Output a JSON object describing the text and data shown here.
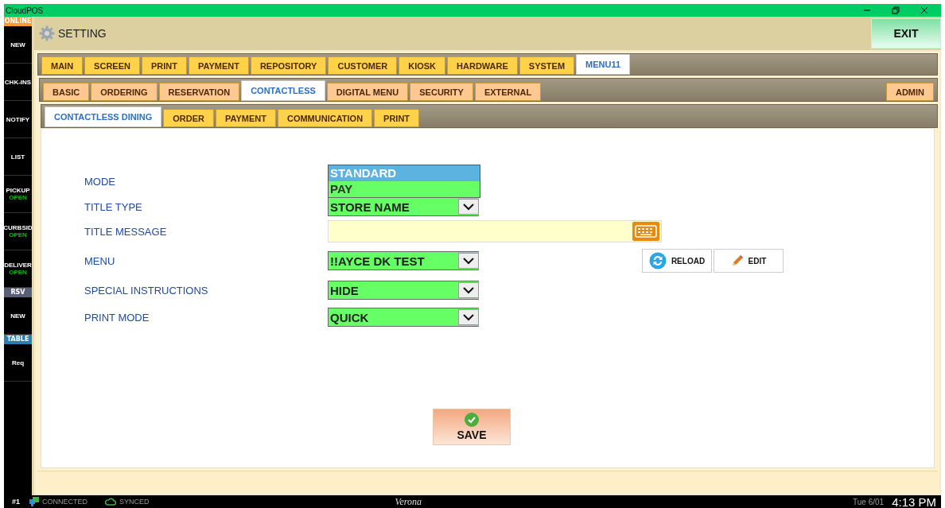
{
  "window": {
    "title": "CloudPOS"
  },
  "sidebar": {
    "items": [
      {
        "kind": "header",
        "label": "ONLINE",
        "color": "#ff9933"
      },
      {
        "kind": "button",
        "label": "NEW"
      },
      {
        "kind": "button",
        "label": "CHK-INS"
      },
      {
        "kind": "button",
        "label": "NOTIFY"
      },
      {
        "kind": "button",
        "label": "LIST"
      },
      {
        "kind": "button",
        "label": "PICKUP",
        "status": "OPEN"
      },
      {
        "kind": "button",
        "label": "CURBSID",
        "status": "OPEN"
      },
      {
        "kind": "button",
        "label": "DELIVER",
        "status": "OPEN"
      },
      {
        "kind": "header",
        "label": "RSV",
        "color": "#5a5f78"
      },
      {
        "kind": "button",
        "label": "NEW"
      },
      {
        "kind": "header",
        "label": "TABLE",
        "color": "#2a7fb0"
      },
      {
        "kind": "button",
        "label": "Req"
      }
    ]
  },
  "header": {
    "title": "SETTING",
    "exit_button": "EXIT"
  },
  "main_tabs": [
    {
      "label": "MAIN",
      "selected": false
    },
    {
      "label": "SCREEN",
      "selected": false
    },
    {
      "label": "PRINT",
      "selected": false
    },
    {
      "label": "PAYMENT",
      "selected": false
    },
    {
      "label": "REPOSITORY",
      "selected": false
    },
    {
      "label": "CUSTOMER",
      "selected": false
    },
    {
      "label": "KIOSK",
      "selected": false
    },
    {
      "label": "HARDWARE",
      "selected": false
    },
    {
      "label": "SYSTEM",
      "selected": false
    },
    {
      "label": "MENU11",
      "selected": true
    }
  ],
  "sub_tabs": [
    {
      "label": "BASIC",
      "selected": false
    },
    {
      "label": "ORDERING",
      "selected": false
    },
    {
      "label": "RESERVATION",
      "selected": false
    },
    {
      "label": "CONTACTLESS",
      "selected": true
    },
    {
      "label": "DIGITAL MENU",
      "selected": false
    },
    {
      "label": "SECURITY",
      "selected": false
    },
    {
      "label": "EXTERNAL",
      "selected": false
    }
  ],
  "admin_tab": {
    "label": "ADMIN",
    "selected": false
  },
  "section_tabs": [
    {
      "label": "CONTACTLESS DINING",
      "selected": true
    },
    {
      "label": "ORDER",
      "selected": false
    },
    {
      "label": "PAYMENT",
      "selected": false
    },
    {
      "label": "COMMUNICATION",
      "selected": false
    },
    {
      "label": "PRINT",
      "selected": false
    }
  ],
  "form": {
    "fields": [
      {
        "label": "MODE",
        "kind": "open_dropdown",
        "options": [
          {
            "label": "STANDARD",
            "selected": true
          },
          {
            "label": "PAY",
            "selected": false
          }
        ]
      },
      {
        "label": "TITLE TYPE",
        "kind": "dropdown",
        "value": "STORE NAME"
      },
      {
        "label": "TITLE MESSAGE",
        "kind": "keyboard_input"
      },
      {
        "label": "MENU",
        "kind": "dropdown",
        "value": "!!AYCE DK TEST",
        "actions": [
          "RELOAD",
          "EDIT"
        ]
      },
      {
        "label": "SPECIAL INSTRUCTIONS",
        "kind": "dropdown",
        "value": "HIDE"
      },
      {
        "label": "PRINT MODE",
        "kind": "dropdown",
        "value": "QUICK"
      }
    ]
  },
  "save_button": "SAVE",
  "status_bar": {
    "terminal": "#1",
    "connection": "CONNECTED",
    "sync": "SYNCED",
    "location": "Verona",
    "date": "Tue 6/01",
    "time": "4:13 PM"
  }
}
